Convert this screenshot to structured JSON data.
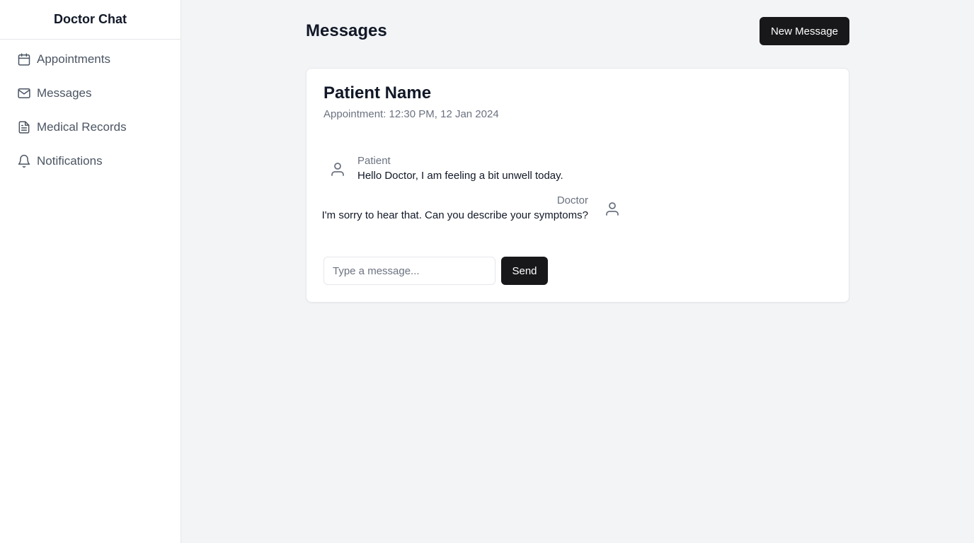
{
  "sidebar": {
    "title": "Doctor Chat",
    "items": [
      {
        "label": "Appointments",
        "icon": "calendar-icon"
      },
      {
        "label": "Messages",
        "icon": "mail-icon"
      },
      {
        "label": "Medical Records",
        "icon": "document-icon"
      },
      {
        "label": "Notifications",
        "icon": "bell-icon"
      }
    ]
  },
  "header": {
    "title": "Messages",
    "new_message_label": "New Message"
  },
  "conversation": {
    "patient_name": "Patient Name",
    "appointment": "Appointment: 12:30 PM, 12 Jan 2024",
    "messages": [
      {
        "sender": "Patient",
        "text": "Hello Doctor, I am feeling a bit unwell today.",
        "icon": "user-icon"
      },
      {
        "sender": "Doctor",
        "text": "I'm sorry to hear that. Can you describe your symptoms?",
        "icon": "user-icon"
      }
    ]
  },
  "composer": {
    "placeholder": "Type a message...",
    "value": "",
    "send_label": "Send"
  },
  "colors": {
    "page_bg": "#f3f4f6",
    "sidebar_bg": "#ffffff",
    "button_bg": "#18181b",
    "text_muted": "#6b7280"
  }
}
